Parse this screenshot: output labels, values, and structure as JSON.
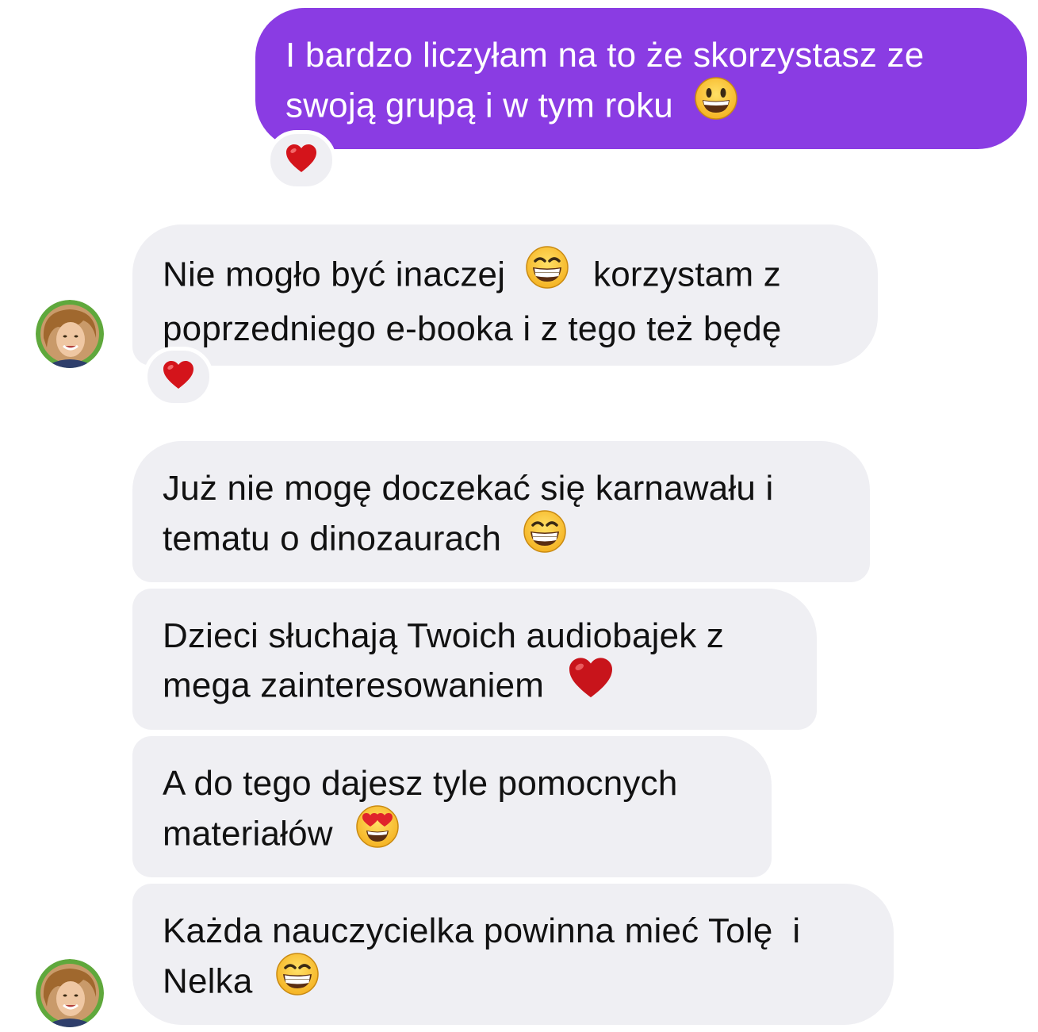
{
  "messages": [
    {
      "id": "m1",
      "direction": "sent",
      "text_line1": "I bardzo liczyłam na to że skorzystasz ze",
      "text_line2": "swoją grupą i w tym roku",
      "emoji": "grinning-face",
      "reaction": "red-heart"
    },
    {
      "id": "m2",
      "direction": "received",
      "text_line1a": "Nie mogło być inaczej",
      "text_line1b": "korzystam z",
      "text_line2": "poprzedniego e-booka i z tego też będę",
      "emoji": "beaming-face",
      "reaction": "red-heart"
    },
    {
      "id": "m3",
      "direction": "received",
      "text_line1": "Już nie mogę doczekać się karnawału i",
      "text_line2": "tematu o dinozaurach",
      "emoji": "beaming-face"
    },
    {
      "id": "m4",
      "direction": "received",
      "text_line1": "Dzieci słuchają Twoich audiobajek z",
      "text_line2": "mega zainteresowaniem",
      "emoji": "red-heart"
    },
    {
      "id": "m5",
      "direction": "received",
      "text_line1": "A do tego dajesz tyle pomocnych",
      "text_line2": "materiałów",
      "emoji": "smiling-face-with-heart-eyes"
    },
    {
      "id": "m6",
      "direction": "received",
      "text_line1": "Każda nauczycielka powinna mieć Tolę  i",
      "text_line2": "Nelka",
      "emoji": "beaming-face"
    }
  ],
  "colors": {
    "sent_bubble": "#8a3ce3",
    "received_bubble": "#efeff3",
    "sent_text": "#ffffff",
    "received_text": "#111111",
    "heart": "#d4141b",
    "avatar_ring": "#5fa83c"
  }
}
